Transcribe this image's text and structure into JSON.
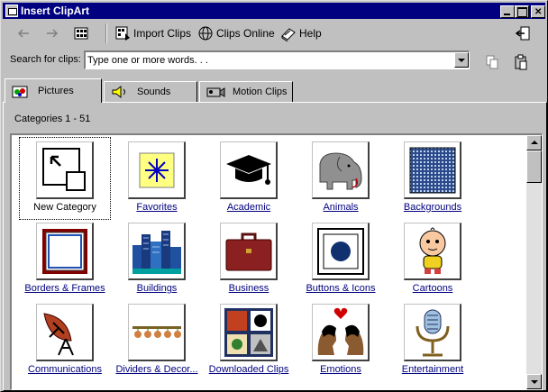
{
  "window": {
    "title": "Insert ClipArt"
  },
  "toolbar": {
    "import_label": "Import Clips",
    "online_label": "Clips Online",
    "help_label": "Help"
  },
  "search": {
    "label": "Search for clips:",
    "value": "Type one or more words. . ."
  },
  "tabs": [
    {
      "label": "Pictures",
      "active": true
    },
    {
      "label": "Sounds",
      "active": false
    },
    {
      "label": "Motion Clips",
      "active": false
    }
  ],
  "categories_count": "Categories 1 - 51",
  "categories": [
    {
      "label": "New Category",
      "icon": "new-category-icon"
    },
    {
      "label": "Favorites",
      "icon": "star-icon"
    },
    {
      "label": "Academic",
      "icon": "graduation-cap-icon"
    },
    {
      "label": "Animals",
      "icon": "elephant-icon"
    },
    {
      "label": "Backgrounds",
      "icon": "grid-pattern-icon"
    },
    {
      "label": "Borders & Frames",
      "icon": "frame-icon"
    },
    {
      "label": "Buildings",
      "icon": "city-skyline-icon"
    },
    {
      "label": "Business",
      "icon": "briefcase-icon"
    },
    {
      "label": "Buttons & Icons",
      "icon": "button-icon"
    },
    {
      "label": "Cartoons",
      "icon": "cartoon-baby-icon"
    },
    {
      "label": "Communications",
      "icon": "satellite-dish-icon"
    },
    {
      "label": "Dividers & Decor...",
      "icon": "divider-icon"
    },
    {
      "label": "Downloaded Clips",
      "icon": "collage-icon"
    },
    {
      "label": "Emotions",
      "icon": "couple-heart-icon"
    },
    {
      "label": "Entertainment",
      "icon": "microphone-icon"
    }
  ],
  "colors": {
    "titlebar": "#000080",
    "link": "#000080",
    "face": "#c0c0c0"
  }
}
